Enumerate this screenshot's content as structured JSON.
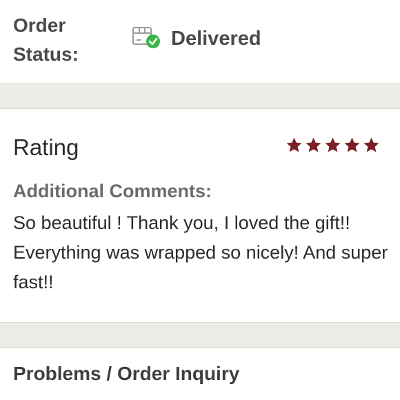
{
  "order_status": {
    "label": "Order Status:",
    "value": "Delivered",
    "icon": "delivered-box-check-icon",
    "check_color": "#3bb54a"
  },
  "rating": {
    "title": "Rating",
    "stars": 5,
    "max_stars": 5,
    "star_color": "#7a1f26",
    "comments_label": "Additional Comments:",
    "comments_text": "So beautiful ! Thank you, I loved the gift!! Everything was wrapped so nicely! And super fast!!"
  },
  "problems": {
    "label": "Problems / Order Inquiry"
  }
}
